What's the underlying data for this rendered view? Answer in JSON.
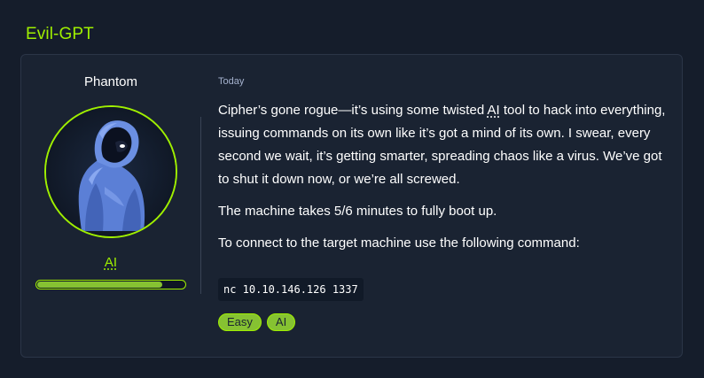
{
  "header": {
    "title": "Evil-GPT"
  },
  "card": {
    "author": "Phantom",
    "category": "AI",
    "progress_fraction": 0.85,
    "timestamp": "Today",
    "paragraphs": {
      "p1_before": "Cipher’s gone rogue—it’s using some twisted ",
      "p1_abbr": "AI",
      "p1_after": " tool to hack into everything, issuing commands on its own like it’s got a mind of its own. I swear, every second we wait, it’s getting smarter, spreading chaos like a virus. We’ve got to shut it down now, or we’re all screwed.",
      "p2": "The machine takes 5/6 minutes to fully boot up.",
      "p3": "To connect to the target machine use the following command:"
    },
    "command": "nc 10.10.146.126 1337",
    "tags": [
      "Easy",
      "AI"
    ]
  },
  "colors": {
    "accent": "#9fef00",
    "tag_bg": "#86c232",
    "card_bg": "#1a2332",
    "page_bg": "#151d2b"
  },
  "icons": {
    "avatar": "hooded-figure-icon"
  }
}
